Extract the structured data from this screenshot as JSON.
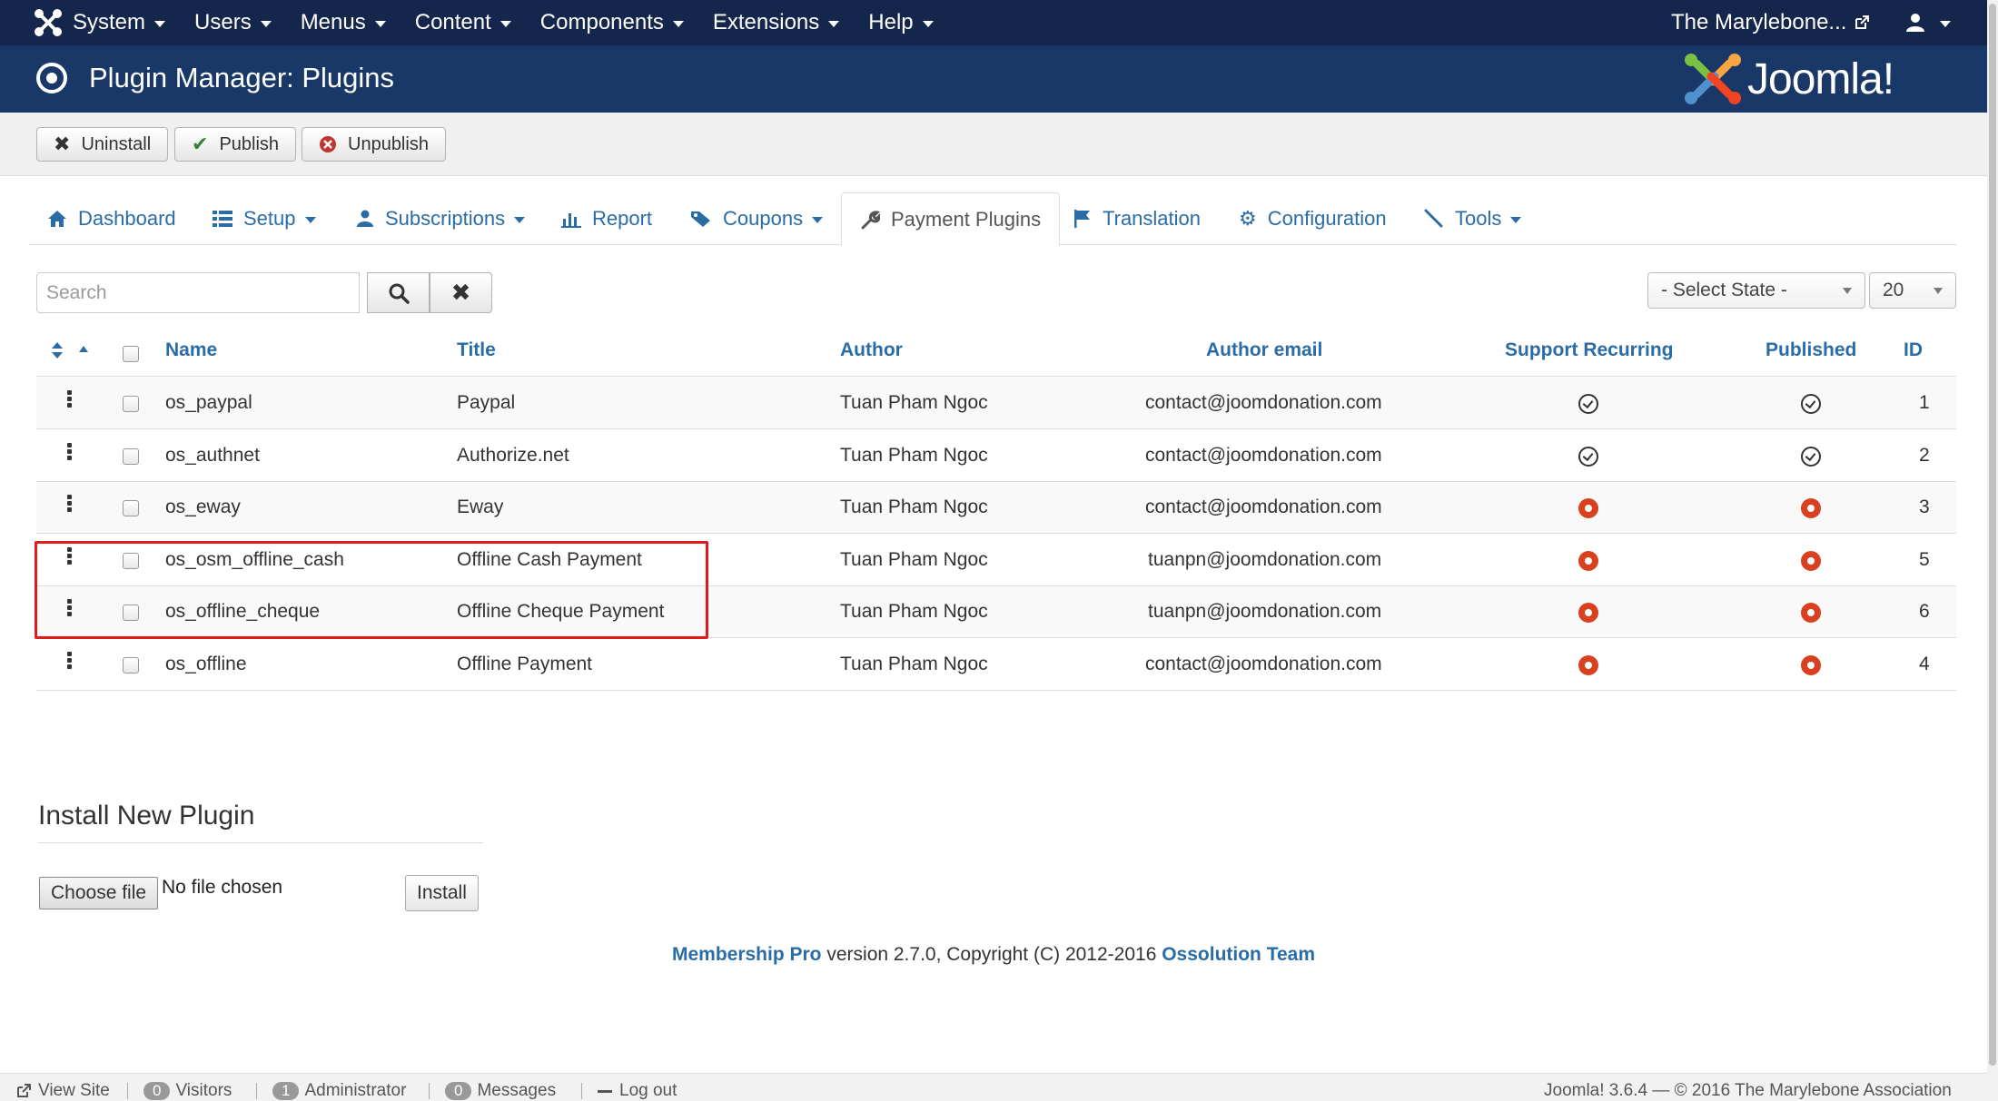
{
  "topnav": {
    "menus": [
      "System",
      "Users",
      "Menus",
      "Content",
      "Components",
      "Extensions",
      "Help"
    ],
    "site_name": "The Marylebone..."
  },
  "titlebar": {
    "title": "Plugin Manager: Plugins",
    "brand": "Joomla!"
  },
  "toolbar": {
    "uninstall": "Uninstall",
    "publish": "Publish",
    "unpublish": "Unpublish"
  },
  "tabs": [
    "Dashboard",
    "Setup",
    "Subscriptions",
    "Report",
    "Coupons",
    "Payment Plugins",
    "Translation",
    "Configuration",
    "Tools"
  ],
  "filter": {
    "search_placeholder": "Search",
    "state": "- Select State -",
    "limit": "20"
  },
  "table": {
    "headers": [
      "Name",
      "Title",
      "Author",
      "Author email",
      "Support Recurring",
      "Published",
      "ID"
    ],
    "rows": [
      {
        "name": "os_paypal",
        "title": "Paypal",
        "author": "Tuan Pham Ngoc",
        "email": "contact@joomdonation.com",
        "recurring": "yes",
        "published": "yes",
        "id": "1"
      },
      {
        "name": "os_authnet",
        "title": "Authorize.net",
        "author": "Tuan Pham Ngoc",
        "email": "contact@joomdonation.com",
        "recurring": "yes",
        "published": "yes",
        "id": "2"
      },
      {
        "name": "os_eway",
        "title": "Eway",
        "author": "Tuan Pham Ngoc",
        "email": "contact@joomdonation.com",
        "recurring": "no",
        "published": "no",
        "id": "3"
      },
      {
        "name": "os_osm_offline_cash",
        "title": "Offline Cash Payment",
        "author": "Tuan Pham Ngoc",
        "email": "tuanpn@joomdonation.com",
        "recurring": "no",
        "published": "no",
        "id": "5"
      },
      {
        "name": "os_offline_cheque",
        "title": "Offline Cheque Payment",
        "author": "Tuan Pham Ngoc",
        "email": "tuanpn@joomdonation.com",
        "recurring": "no",
        "published": "no",
        "id": "6"
      },
      {
        "name": "os_offline",
        "title": "Offline Payment",
        "author": "Tuan Pham Ngoc",
        "email": "contact@joomdonation.com",
        "recurring": "no",
        "published": "no",
        "id": "4"
      }
    ]
  },
  "install": {
    "heading": "Install New Plugin",
    "choose": "Choose file",
    "no_file": "No file chosen",
    "button": "Install"
  },
  "credit": {
    "product": "Membership Pro",
    "text": " version 2.7.0, Copyright (C) 2012-2016 ",
    "team": "Ossolution Team"
  },
  "statusbar": {
    "view_site": "View Site",
    "visitors_count": "0",
    "visitors": "Visitors",
    "admin_count": "1",
    "admin": "Administrator",
    "messages_count": "0",
    "messages": "Messages",
    "logout": "Log out",
    "version": "Joomla! 3.6.4 — © 2016 The Marylebone Association"
  },
  "colors": {
    "navbar": "#14264b",
    "titlebar": "#1a3867",
    "link": "#2a6ca5",
    "unpublished": "#d9401f",
    "highlight": "#e01b1b"
  }
}
